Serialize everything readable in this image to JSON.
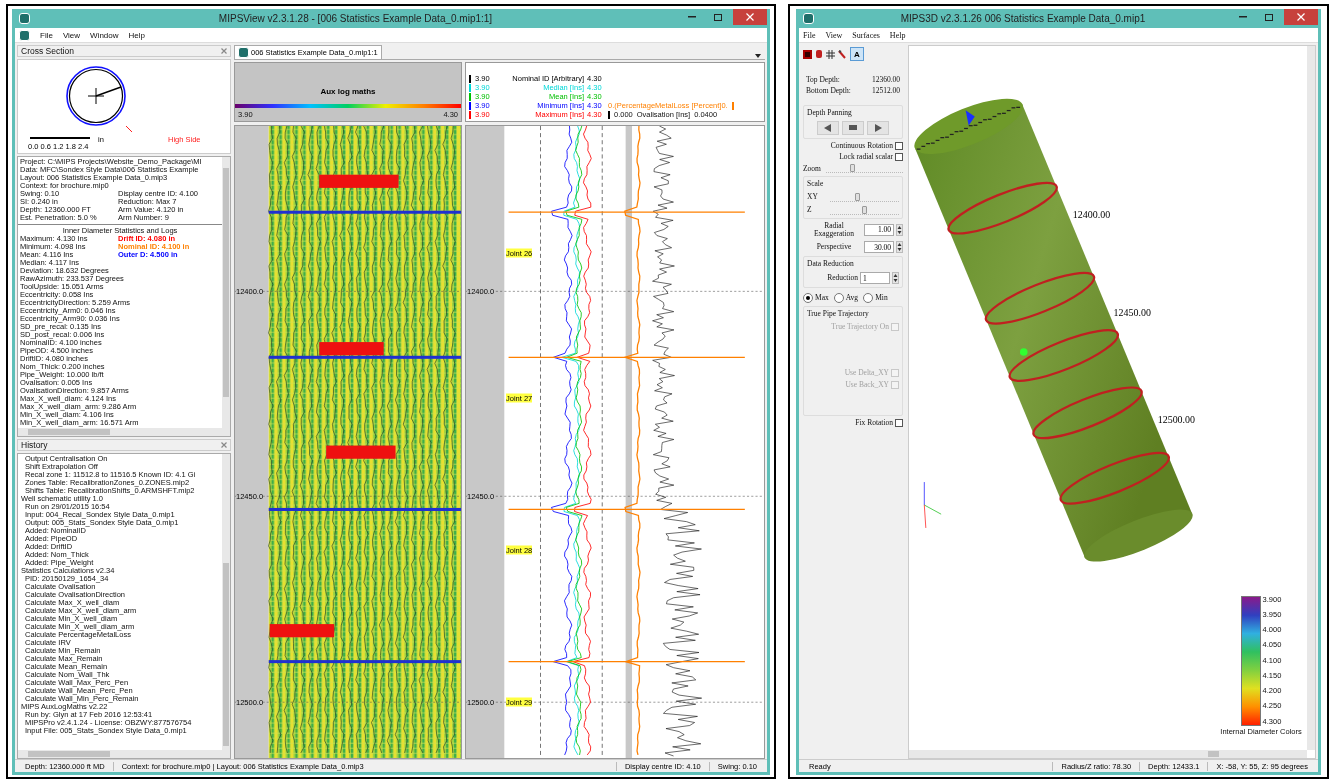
{
  "left_window": {
    "title": "MIPSView v2.3.1.28 - [006 Statistics Example Data_0.mip1:1]",
    "menu": [
      "File",
      "View",
      "Window",
      "Help"
    ],
    "cross_section": {
      "title": "Cross Section",
      "scale": "0.0 0.6 1.2 1.8 2.4",
      "unit": "in",
      "high_side": "High Side"
    },
    "info": {
      "lines": [
        "Project: C:\\MIPS Projects\\Website_Demo_Package\\MI",
        "Data: MFC\\Sondex Style Data\\006 Statistics Example",
        "Layout: 006 Statistics Example Data_0.mip3",
        "Context: for brochure.mip0"
      ],
      "pairs": [
        {
          "left": "Swing:  0.10",
          "right": "Display centre ID:  4.100"
        },
        {
          "left": "SI: 0.240 in",
          "right": "Reduction: Max  7"
        },
        {
          "left": "Depth: 12360.000 FT",
          "right": "Arm Value:  4.120 in"
        },
        {
          "left": "Est. Penetration:   5.0 %",
          "right": "Arm Number: 9"
        }
      ],
      "stats_title": "Inner Diameter Statistics and Logs",
      "stats": [
        {
          "text": "Maximum:  4.130 Ins",
          "extra": "Drift ID:  4.080 in",
          "color": "#ff0000"
        },
        {
          "text": "Minimum:  4.098 Ins",
          "extra": "Nominal ID:  4.100 in",
          "color": "#ff8000"
        },
        {
          "text": "Mean:  4.116 Ins",
          "extra": "Outer D:  4.500 in",
          "color": "#0000ff"
        },
        {
          "text": "Median:  4.117 Ins"
        },
        {
          "text": "Deviation: 18.632 Degrees"
        },
        {
          "text": "RawAzimuth: 233.537 Degrees"
        },
        {
          "text": "ToolUpside: 15.051 Arms"
        },
        {
          "text": "Eccentricity:  0.058 Ins"
        },
        {
          "text": "EccentricityDirection:  5.259 Arms"
        },
        {
          "text": "Eccentricity_Arm0:  0.046 Ins"
        },
        {
          "text": "Eccentricity_Arm90:  0.036 Ins"
        },
        {
          "text": "SD_pre_recal:  0.135 Ins"
        },
        {
          "text": "SD_post_recal:  0.006 Ins"
        },
        {
          "text": "NominalID:  4.100 inches"
        },
        {
          "text": "PipeOD:  4.500 inches"
        },
        {
          "text": "DriftID:  4.080 inches"
        },
        {
          "text": "Nom_Thick:  0.200 inches"
        },
        {
          "text": "Pipe_Weight: 10.000 lb/ft"
        },
        {
          "text": "Ovalisation:  0.005 Ins"
        },
        {
          "text": "OvalisationDirection:  9.857 Arms"
        },
        {
          "text": "Max_X_well_diam:  4.124 Ins"
        },
        {
          "text": "Max_X_well_diam_arm:  9.286 Arm"
        },
        {
          "text": "Min_X_well_diam:  4.106 Ins"
        },
        {
          "text": "Min_X_well_diam_arm: 16.571 Arm"
        }
      ]
    },
    "history": {
      "title": "History",
      "entries": [
        {
          "children": [
            "Output Centralisation On",
            "Shift Extrapolation Off",
            "Recal zone 1: 11512.8 to 11516.5 Known ID: 4.1 Gi",
            "Zones Table: RecalibrationZones_0.ZONES.mip2",
            "Shifts Table: RecalibrationShifts_0.ARMSHFT.mip2"
          ]
        },
        {
          "text": "Well schematic utility 1.0",
          "children": [
            "Run on 29/01/2015 16:54",
            "Input: 004_Recal_Sondex Style Data_0.mip1",
            "Output: 005_Stats_Sondex Style Data_0.mip1",
            "Added: NominalID",
            "Added: PipeOD",
            "Added: DriftID",
            "Added: Nom_Thick",
            "Added: Pipe_Weight"
          ]
        },
        {
          "text": "Statistics Calculations v2.34",
          "children": [
            "PID: 20150129_1654_34",
            "Calculate Ovalisation",
            "Calculate OvalisationDirection",
            "Calculate Max_X_well_diam",
            "Calculate Max_X_well_diam_arm",
            "Calculate Min_X_well_diam",
            "Calculate Min_X_well_diam_arm",
            "Calculate PercentageMetalLoss",
            "Calculate IRV",
            "Calculate Min_Remain",
            "Calculate Max_Remain",
            "Calculate Mean_Remain",
            "Calculate Nom_Wall_Thk",
            "Calculate Wall_Max_Perc_Pen",
            "Calculate Wall_Mean_Perc_Pen",
            "Calculate Wall_Min_Perc_Remain"
          ]
        },
        {
          "text": "MIPS AuxLogMaths v2.22",
          "children": [
            "Run by: Glyn at 17 Feb 2016 12:53:41",
            "MIPSPro v2.4.1.24 - License: OBZWY:877576754",
            "Input File: 005_Stats_Sondex Style Data_0.mip1"
          ]
        }
      ]
    },
    "document_tab": "006 Statistics Example Data_0.mip1:1",
    "image_track": {
      "title": "Aux log maths",
      "min": "3.90",
      "max": "4.30",
      "depth_labels": [
        "12400.0",
        "12450.0",
        "12500.0"
      ]
    },
    "legend": [
      {
        "min": "3.90",
        "name": "Nominal ID [Arbitrary]",
        "max": "4.30",
        "color": "#000000"
      },
      {
        "min": "3.90",
        "name": "Median [Ins]",
        "max": "4.30",
        "color": "#00d8d8"
      },
      {
        "min": "3.90",
        "name": "Mean [Ins]",
        "max": "4.30",
        "color": "#00c000"
      },
      {
        "min": "3.90",
        "name": "Minimum [Ins]",
        "max": "4.30",
        "color": "#0000ff",
        "extra": {
          "kind": "single",
          "text": "0.(PercentageMetalLoss [Percent]0.",
          "color": "#ff8000"
        }
      },
      {
        "min": "3.90",
        "name": "Maximum [Ins]",
        "max": "4.30",
        "color": "#ff0000",
        "extra": {
          "kind": "range",
          "min": "0.000",
          "name": "Ovalisation [Ins]",
          "max": "0.0400",
          "color": "#000000"
        }
      }
    ],
    "curve_track": {
      "depth_labels": [
        "12400.0",
        "12450.0",
        "12500.0"
      ],
      "joints": [
        "Joint 26",
        "Joint 27",
        "Joint 28",
        "Joint 29"
      ]
    },
    "status": [
      "Depth: 12360.000  ft MD",
      "Context: for brochure.mip0 | Layout: 006 Statistics Example Data_0.mip3",
      "Display centre ID: 4.10",
      "Swing: 0.10"
    ]
  },
  "right_window": {
    "title": "MIPS3D v2.3.1.26  006 Statistics Example Data_0.mip1",
    "menu": [
      "File",
      "View",
      "Surfaces",
      "Help"
    ],
    "toolbar_text": {
      "label": "A",
      "selected": true
    },
    "top_depth": {
      "label": "Top Depth:",
      "value": "12360.00"
    },
    "bottom_depth": {
      "label": "Bottom Depth:",
      "value": "12512.00"
    },
    "panning_title": "Depth Panning",
    "checks": [
      {
        "label": "Continuous Rotation",
        "checked": false
      },
      {
        "label": "Lock radial scalar",
        "checked": false
      }
    ],
    "zoom": {
      "label": "Zoom",
      "level": 0.35
    },
    "scale": {
      "title": "Scale",
      "sliders": [
        {
          "label": "XY",
          "level": 0.4
        },
        {
          "label": "Z",
          "level": 0.5
        }
      ]
    },
    "spins": [
      {
        "label": "Radial Exaggeration",
        "value": "1.00"
      },
      {
        "label": "Perspective",
        "value": "30.00"
      }
    ],
    "reduction": {
      "title": "Data Reduction",
      "label": "Reduction",
      "value": "1",
      "radios": [
        {
          "label": "Max",
          "selected": true
        },
        {
          "label": "Avg",
          "selected": false
        },
        {
          "label": "Min",
          "selected": false
        }
      ]
    },
    "trajectory": {
      "title": "True Pipe Trajectory",
      "checks": [
        {
          "label": "True Trajectory On",
          "checked": false,
          "disabled": true
        },
        {
          "label": "Use Delta_XY",
          "checked": false,
          "disabled": true
        },
        {
          "label": "Use Back_XY",
          "checked": false,
          "disabled": true
        }
      ]
    },
    "fix_rotation": {
      "label": "Fix Rotation",
      "checked": false
    },
    "depth_labels": [
      "12400.00",
      "12450.00",
      "12500.00"
    ],
    "colorbar": {
      "labels": [
        "3.900",
        "3.950",
        "4.000",
        "4.050",
        "4.100",
        "4.150",
        "4.200",
        "4.250",
        "4.300"
      ],
      "title": "Internal Diameter Colors"
    },
    "status": [
      "Ready",
      "Radius/Z ratio: 78.30",
      "Depth: 12433.1",
      "X: -58, Y: 55, Z: 95 degrees"
    ]
  }
}
